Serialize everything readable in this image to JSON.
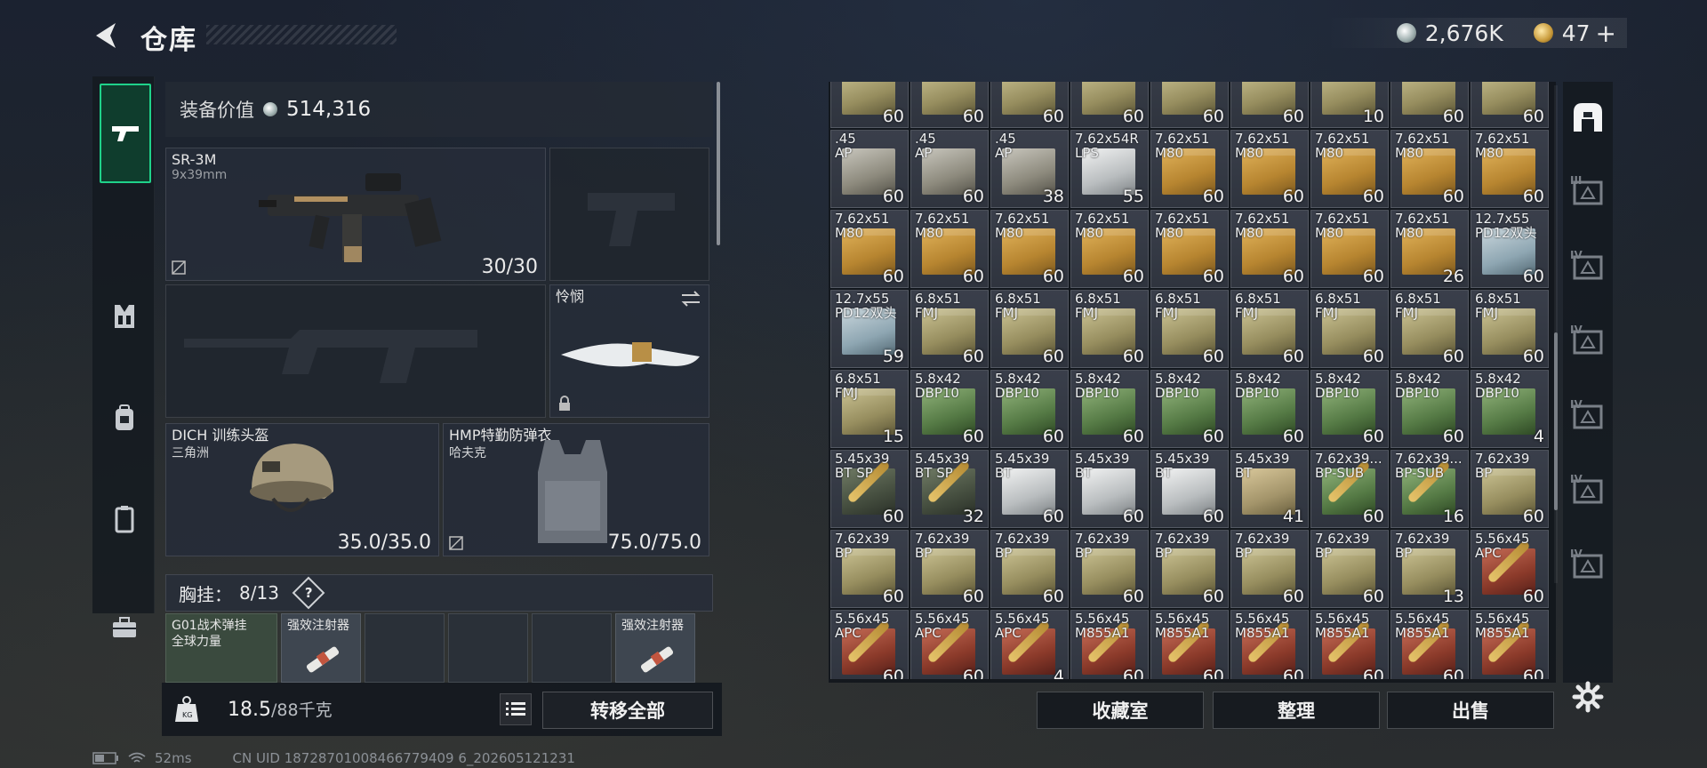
{
  "header": {
    "title": "仓库"
  },
  "currency": {
    "silver": "2,676K",
    "gold": "47",
    "plus": "+"
  },
  "equipment": {
    "value_label": "装备价值",
    "value": "514,316",
    "primary_weapon": {
      "name": "SR-3M",
      "caliber": "9x39mm",
      "ammo": "30/30"
    },
    "melee": {
      "name": "怜悯"
    },
    "helmet": {
      "name": "DICH 训练头盔",
      "sub": "三角洲",
      "durability": "35.0/35.0"
    },
    "armor": {
      "name": "HMP特勤防弹衣",
      "sub": "哈夫克",
      "durability": "75.0/75.0"
    },
    "chest_rig": {
      "label": "胸挂：",
      "count": "8/13",
      "help": "?"
    },
    "chest_items": [
      {
        "name": "G01战术弹挂\n全球力量",
        "color": "#3a4a3e"
      },
      {
        "name": "强效注射器",
        "color": "#3e4650"
      },
      {
        "name": "",
        "color": "#2a3038"
      },
      {
        "name": "",
        "color": "#2a3038"
      },
      {
        "name": "",
        "color": "#2a3038"
      },
      {
        "name": "强效注射器",
        "color": "#3e4650"
      }
    ]
  },
  "weight": {
    "current": "18.5",
    "max": "/88千克"
  },
  "buttons": {
    "move_all": "转移全部",
    "collection": "收藏室",
    "sort": "整理",
    "sell": "出售"
  },
  "status": {
    "ping": "52ms",
    "uid": "CN UID 18728701008466779409 6_202605121231"
  },
  "inventory": [
    {
      "cal": "",
      "count": "60",
      "box": "olive"
    },
    {
      "cal": "",
      "count": "60",
      "box": "olive"
    },
    {
      "cal": "",
      "count": "60",
      "box": "olive"
    },
    {
      "cal": "",
      "count": "60",
      "box": "olive"
    },
    {
      "cal": "",
      "count": "60",
      "box": "olive"
    },
    {
      "cal": "",
      "count": "60",
      "box": "olive"
    },
    {
      "cal": "",
      "count": "10",
      "box": "olive"
    },
    {
      "cal": "",
      "count": "60",
      "box": "olive"
    },
    {
      "cal": "",
      "count": "60",
      "box": "olive"
    },
    {
      "cal": ".45\nAP",
      "count": "60",
      "box": "grey"
    },
    {
      "cal": ".45\nAP",
      "count": "60",
      "box": "grey"
    },
    {
      "cal": ".45\nAP",
      "count": "38",
      "box": "grey"
    },
    {
      "cal": "7.62x54R\nLPS",
      "count": "55",
      "box": "white"
    },
    {
      "cal": "7.62x51\nM80",
      "count": "60",
      "box": "tan"
    },
    {
      "cal": "7.62x51\nM80",
      "count": "60",
      "box": "tan"
    },
    {
      "cal": "7.62x51\nM80",
      "count": "60",
      "box": "tan"
    },
    {
      "cal": "7.62x51\nM80",
      "count": "60",
      "box": "tan"
    },
    {
      "cal": "7.62x51\nM80",
      "count": "60",
      "box": "tan"
    },
    {
      "cal": "7.62x51\nM80",
      "count": "60",
      "box": "tan"
    },
    {
      "cal": "7.62x51\nM80",
      "count": "60",
      "box": "tan"
    },
    {
      "cal": "7.62x51\nM80",
      "count": "60",
      "box": "tan"
    },
    {
      "cal": "7.62x51\nM80",
      "count": "60",
      "box": "tan"
    },
    {
      "cal": "7.62x51\nM80",
      "count": "60",
      "box": "tan"
    },
    {
      "cal": "7.62x51\nM80",
      "count": "60",
      "box": "tan"
    },
    {
      "cal": "7.62x51\nM80",
      "count": "60",
      "box": "tan"
    },
    {
      "cal": "7.62x51\nM80",
      "count": "26",
      "box": "tan"
    },
    {
      "cal": "12.7x55\nPD12双头",
      "count": "60",
      "box": "lightblue"
    },
    {
      "cal": "12.7x55\nPD12双头",
      "count": "59",
      "box": "lightblue"
    },
    {
      "cal": "6.8x51\nFMJ",
      "count": "60",
      "box": "olive"
    },
    {
      "cal": "6.8x51\nFMJ",
      "count": "60",
      "box": "olive"
    },
    {
      "cal": "6.8x51\nFMJ",
      "count": "60",
      "box": "olive"
    },
    {
      "cal": "6.8x51\nFMJ",
      "count": "60",
      "box": "olive"
    },
    {
      "cal": "6.8x51\nFMJ",
      "count": "60",
      "box": "olive"
    },
    {
      "cal": "6.8x51\nFMJ",
      "count": "60",
      "box": "olive"
    },
    {
      "cal": "6.8x51\nFMJ",
      "count": "60",
      "box": "olive"
    },
    {
      "cal": "6.8x51\nFMJ",
      "count": "60",
      "box": "olive"
    },
    {
      "cal": "6.8x51\nFMJ",
      "count": "15",
      "box": "olive"
    },
    {
      "cal": "5.8x42\nDBP10",
      "count": "60",
      "box": "green"
    },
    {
      "cal": "5.8x42\nDBP10",
      "count": "60",
      "box": "green"
    },
    {
      "cal": "5.8x42\nDBP10",
      "count": "60",
      "box": "green"
    },
    {
      "cal": "5.8x42\nDBP10",
      "count": "60",
      "box": "green"
    },
    {
      "cal": "5.8x42\nDBP10",
      "count": "60",
      "box": "green"
    },
    {
      "cal": "5.8x42\nDBP10",
      "count": "60",
      "box": "green"
    },
    {
      "cal": "5.8x42\nDBP10",
      "count": "60",
      "box": "green"
    },
    {
      "cal": "5.8x42\nDBP10",
      "count": "4",
      "box": "green"
    },
    {
      "cal": "5.45x39\nBT SP",
      "count": "60",
      "box": "dark"
    },
    {
      "cal": "5.45x39\nBT SP",
      "count": "32",
      "box": "dark"
    },
    {
      "cal": "5.45x39\nBT",
      "count": "60",
      "box": "white"
    },
    {
      "cal": "5.45x39\nBT",
      "count": "60",
      "box": "white"
    },
    {
      "cal": "5.45x39\nBT",
      "count": "60",
      "box": "white"
    },
    {
      "cal": "5.45x39\nBT",
      "count": "41",
      "box": "tanstrip"
    },
    {
      "cal": "7.62x39...\nBP-SUB",
      "count": "60",
      "box": "green"
    },
    {
      "cal": "7.62x39...\nBP-SUB",
      "count": "16",
      "box": "green"
    },
    {
      "cal": "7.62x39\nBP",
      "count": "60",
      "box": "olive"
    },
    {
      "cal": "7.62x39\nBP",
      "count": "60",
      "box": "olive"
    },
    {
      "cal": "7.62x39\nBP",
      "count": "60",
      "box": "olive"
    },
    {
      "cal": "7.62x39\nBP",
      "count": "60",
      "box": "olive"
    },
    {
      "cal": "7.62x39\nBP",
      "count": "60",
      "box": "olive"
    },
    {
      "cal": "7.62x39\nBP",
      "count": "60",
      "box": "olive"
    },
    {
      "cal": "7.62x39\nBP",
      "count": "60",
      "box": "olive"
    },
    {
      "cal": "7.62x39\nBP",
      "count": "60",
      "box": "olive"
    },
    {
      "cal": "7.62x39\nBP",
      "count": "13",
      "box": "olive"
    },
    {
      "cal": "5.56x45\nAPC",
      "count": "60",
      "box": "red"
    },
    {
      "cal": "5.56x45\nAPC",
      "count": "60",
      "box": "red"
    },
    {
      "cal": "5.56x45\nAPC",
      "count": "60",
      "box": "red"
    },
    {
      "cal": "5.56x45\nAPC",
      "count": "4",
      "box": "red"
    },
    {
      "cal": "5.56x45\nM855A1",
      "count": "60",
      "box": "red"
    },
    {
      "cal": "5.56x45\nM855A1",
      "count": "60",
      "box": "red"
    },
    {
      "cal": "5.56x45\nM855A1",
      "count": "60",
      "box": "red"
    },
    {
      "cal": "5.56x45\nM855A1",
      "count": "60",
      "box": "red"
    },
    {
      "cal": "5.56x45\nM855A1",
      "count": "60",
      "box": "red"
    },
    {
      "cal": "5.56x45\nM855A1",
      "count": "60",
      "box": "red"
    }
  ],
  "right_nav": [
    "home-safe-icon",
    "container-iii-icon",
    "container-iv-icon",
    "container-iv-b-icon",
    "container-iv-c-icon",
    "container-iv-d-icon",
    "container-iv-e-icon"
  ],
  "right_nav_labels": [
    "",
    "III",
    "IV",
    "IV",
    "IV",
    "IV",
    "IV"
  ]
}
